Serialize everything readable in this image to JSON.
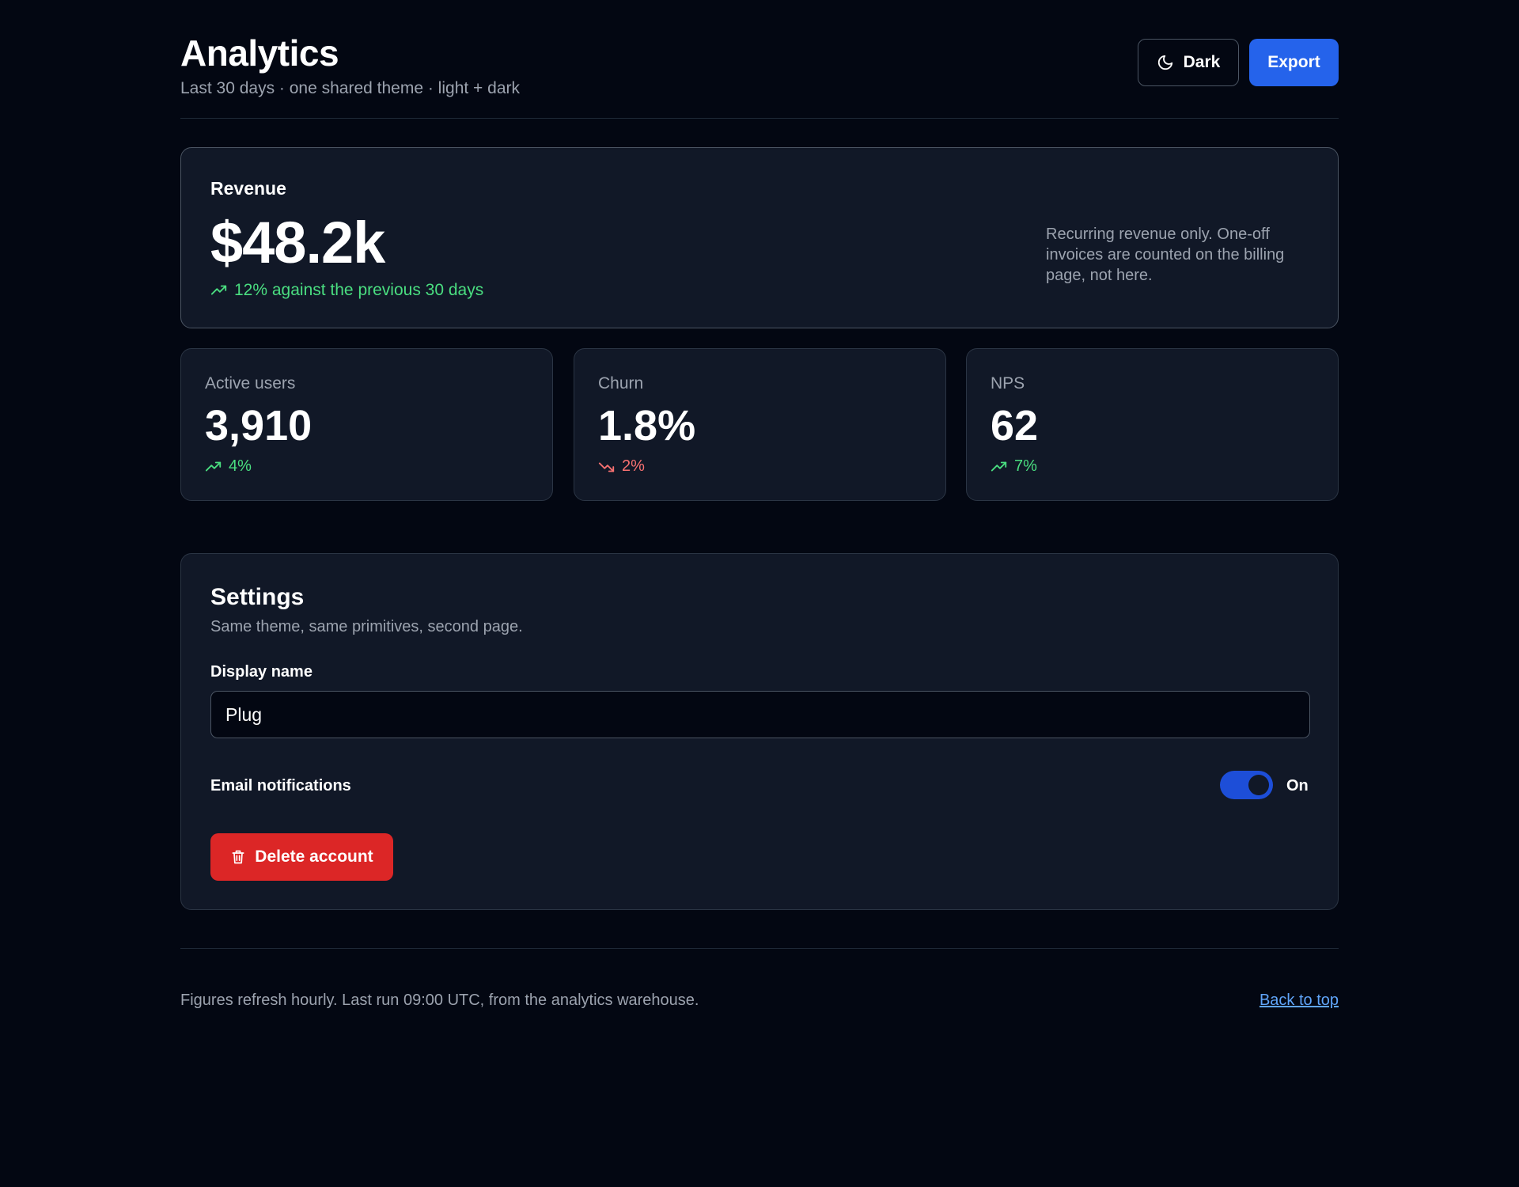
{
  "header": {
    "title": "Analytics",
    "subtitle": "Last 30 days · one shared theme · light + dark",
    "theme_button_label": "Dark",
    "theme_button_icon": "moon-icon",
    "export_label": "Export"
  },
  "revenue": {
    "label": "Revenue",
    "value": "$48.2k",
    "trend": "12% against the previous 30 days",
    "trend_direction": "up",
    "note": "Recurring revenue only. One-off invoices are counted on the billing page, not here."
  },
  "stats": [
    {
      "label": "Active users",
      "value": "3,910",
      "trend": "4%",
      "direction": "up"
    },
    {
      "label": "Churn",
      "value": "1.8%",
      "trend": "2%",
      "direction": "down"
    },
    {
      "label": "NPS",
      "value": "62",
      "trend": "7%",
      "direction": "up"
    }
  ],
  "settings": {
    "title": "Settings",
    "subtitle": "Same theme, same primitives, second page.",
    "display_name_label": "Display name",
    "display_name_value": "Plug",
    "email_notifications_label": "Email notifications",
    "email_notifications_state": "On",
    "delete_label": "Delete account",
    "delete_icon": "trash-icon"
  },
  "footer": {
    "text": "Figures refresh hourly. Last run 09:00 UTC, from the analytics warehouse.",
    "back_to_top": "Back to top"
  },
  "colors": {
    "background": "#030712",
    "card": "#111827",
    "primary": "#2563eb",
    "danger": "#dc2626",
    "positive": "#4ade80",
    "negative": "#f87171",
    "link": "#60a5fa"
  }
}
